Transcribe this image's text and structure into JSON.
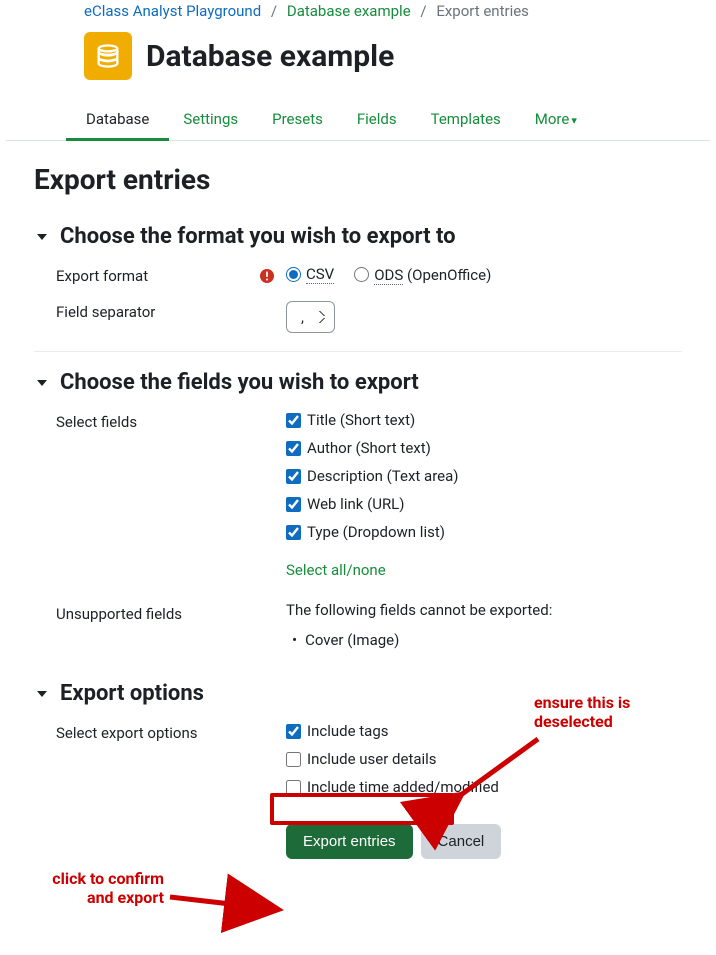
{
  "breadcrumb": {
    "root": "eClass Analyst Playground",
    "mid": "Database example",
    "current": "Export entries"
  },
  "header": {
    "title": "Database example"
  },
  "tabs": {
    "items": [
      {
        "label": "Database",
        "active": true
      },
      {
        "label": "Settings"
      },
      {
        "label": "Presets"
      },
      {
        "label": "Fields"
      },
      {
        "label": "Templates"
      },
      {
        "label": "More"
      }
    ]
  },
  "page": {
    "heading": "Export entries"
  },
  "section_format": {
    "title": "Choose the format you wish to export to",
    "export_format_label": "Export format",
    "field_sep_label": "Field separator",
    "csv_label": "CSV",
    "ods_label": "ODS",
    "ods_suffix": " (OpenOffice)",
    "separator_value": ","
  },
  "section_fields": {
    "title": "Choose the fields you wish to export",
    "select_fields_label": "Select fields",
    "fields": [
      {
        "label": "Title (Short text)",
        "checked": true
      },
      {
        "label": "Author (Short text)",
        "checked": true
      },
      {
        "label": "Description (Text area)",
        "checked": true
      },
      {
        "label": "Web link (URL)",
        "checked": true
      },
      {
        "label": "Type (Dropdown list)",
        "checked": true
      }
    ],
    "select_all_none": "Select all/none",
    "unsupported_label": "Unsupported fields",
    "unsupported_text": "The following fields cannot be exported:",
    "unsupported_items": [
      "Cover (Image)"
    ]
  },
  "section_options": {
    "title": "Export options",
    "select_opts_label": "Select export options",
    "opts": [
      {
        "label": "Include tags",
        "checked": true
      },
      {
        "label": "Include user details",
        "checked": false
      },
      {
        "label": "Include time added/modified",
        "checked": false
      }
    ]
  },
  "buttons": {
    "primary": "Export entries",
    "cancel": "Cancel"
  },
  "annotations": {
    "deselect": "ensure this is\ndeselected",
    "confirm": "click to confirm\nand export"
  }
}
